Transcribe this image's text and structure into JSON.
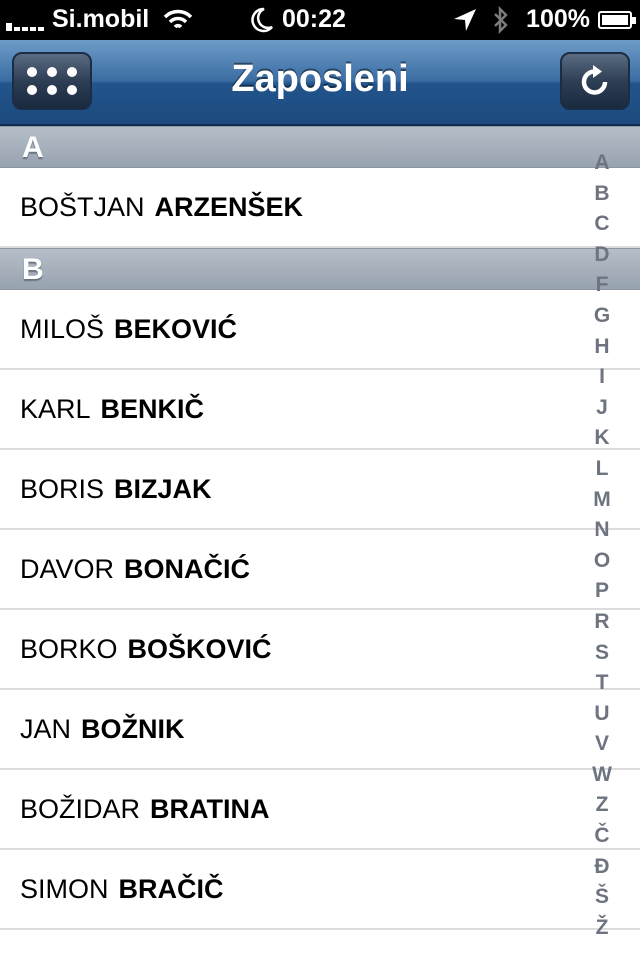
{
  "status_bar": {
    "carrier": "Si.mobil",
    "time": "00:22",
    "battery": "100%"
  },
  "nav": {
    "title": "Zaposleni"
  },
  "sections": [
    {
      "letter": "A",
      "rows": [
        {
          "first": "BOŠTJAN",
          "last": "ARZENŠEK"
        }
      ]
    },
    {
      "letter": "B",
      "rows": [
        {
          "first": "MILOŠ",
          "last": "BEKOVIĆ"
        },
        {
          "first": "KARL",
          "last": "BENKIČ"
        },
        {
          "first": "BORIS",
          "last": "BIZJAK"
        },
        {
          "first": "DAVOR",
          "last": "BONAČIĆ"
        },
        {
          "first": "BORKO",
          "last": "BOŠKOVIĆ"
        },
        {
          "first": "JAN",
          "last": "BOŽNIK"
        },
        {
          "first": "BOŽIDAR",
          "last": "BRATINA"
        },
        {
          "first": "SIMON",
          "last": "BRAČIČ"
        }
      ]
    }
  ],
  "index_letters": [
    "A",
    "B",
    "C",
    "D",
    "F",
    "G",
    "H",
    "I",
    "J",
    "K",
    "L",
    "M",
    "N",
    "O",
    "P",
    "R",
    "S",
    "T",
    "U",
    "V",
    "W",
    "Z",
    "Č",
    "Đ",
    "Š",
    "Ž"
  ],
  "icons": {
    "menu": "grid-dots-icon",
    "refresh": "refresh-icon"
  }
}
